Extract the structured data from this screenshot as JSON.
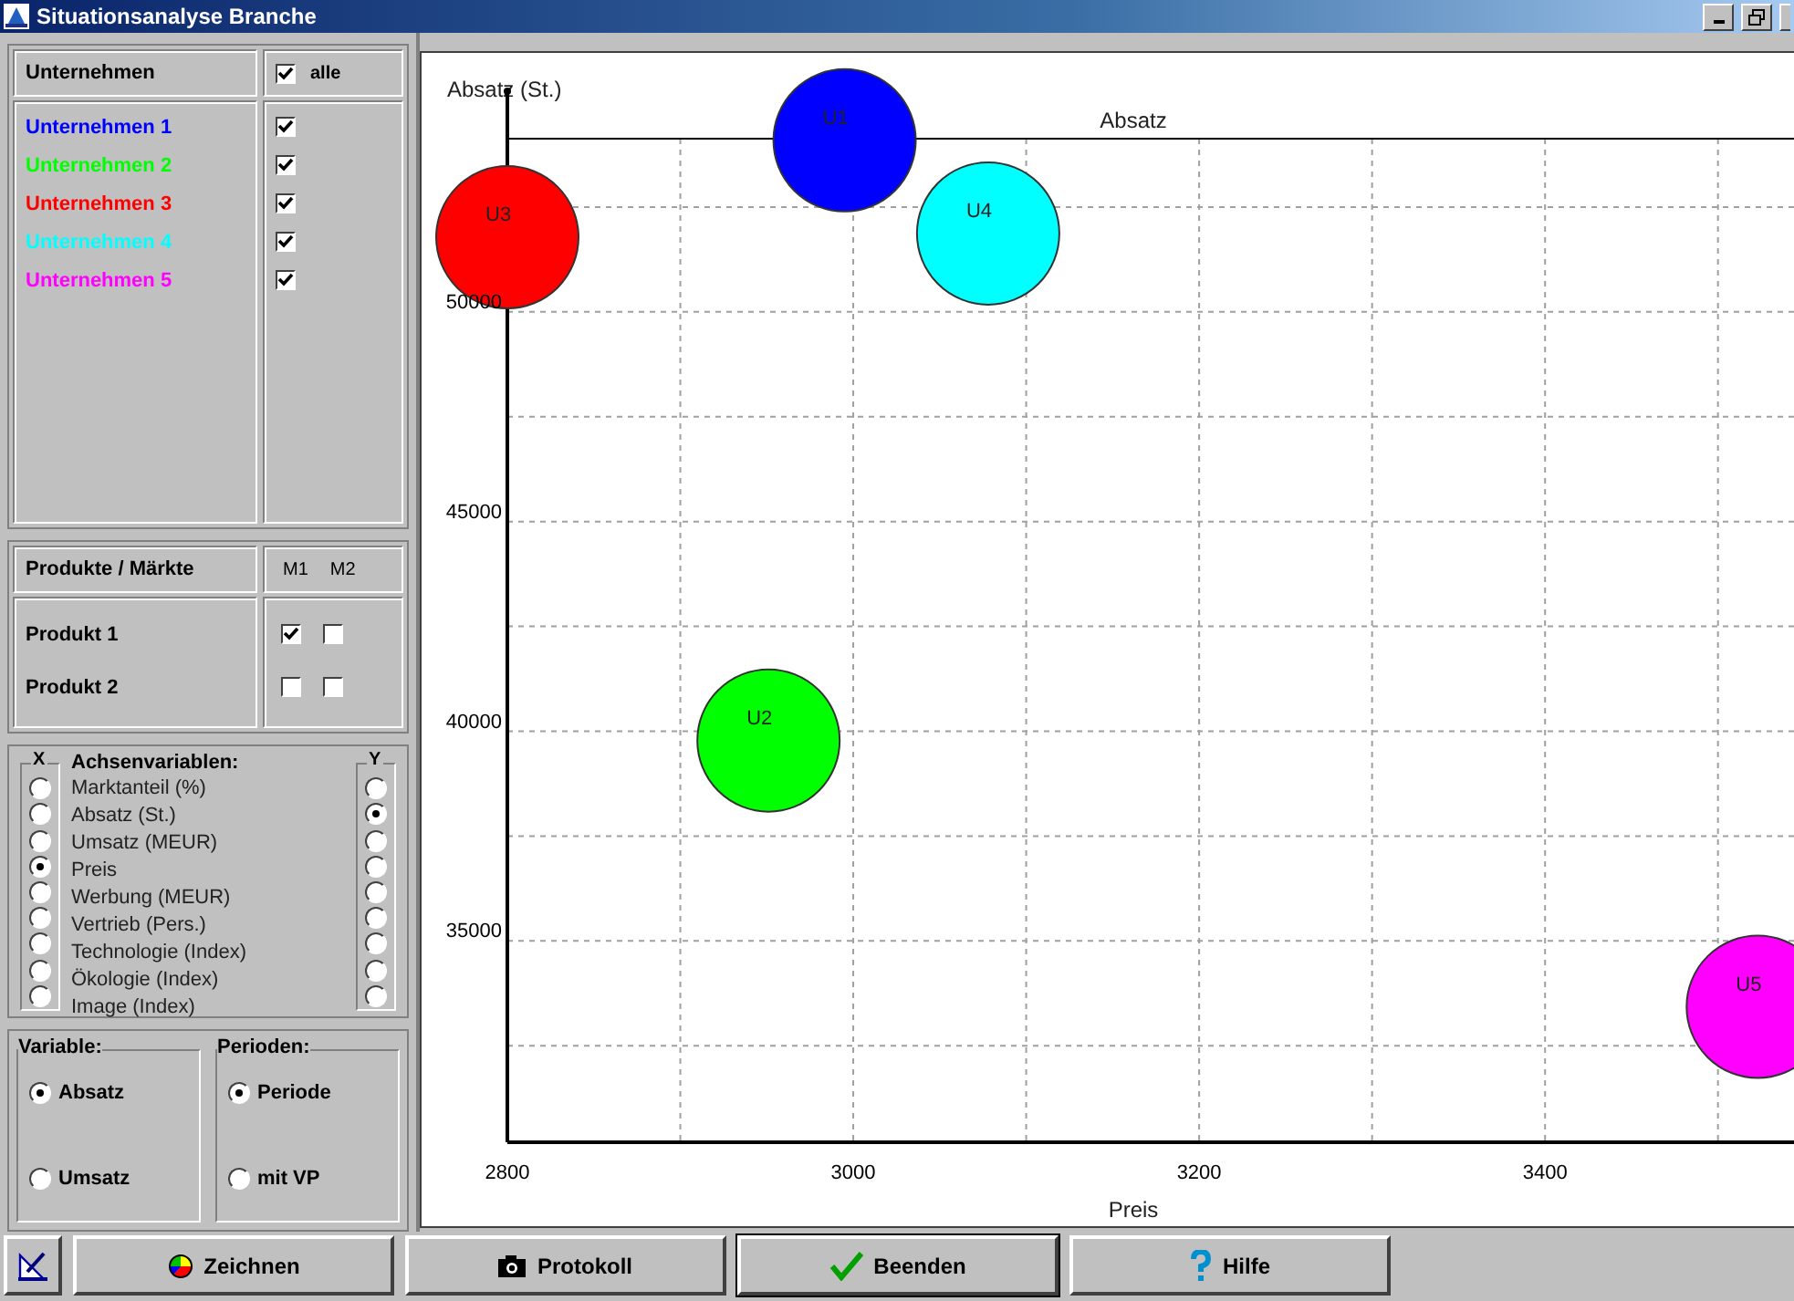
{
  "window": {
    "title": "Situationsanalyse Branche"
  },
  "companies": {
    "header": "Unternehmen",
    "all_label": "alle",
    "all_checked": true,
    "items": [
      {
        "label": "Unternehmen 1",
        "color": "#0000ff",
        "checked": true
      },
      {
        "label": "Unternehmen 2",
        "color": "#00ff00",
        "checked": true
      },
      {
        "label": "Unternehmen 3",
        "color": "#ff0000",
        "checked": true
      },
      {
        "label": "Unternehmen 4",
        "color": "#00ffff",
        "checked": true
      },
      {
        "label": "Unternehmen 5",
        "color": "#ff00ff",
        "checked": true
      }
    ]
  },
  "products": {
    "header": "Produkte / Märkte",
    "columns": [
      "M1",
      "M2"
    ],
    "items": [
      {
        "label": "Produkt 1",
        "m1_checked": true,
        "m2_checked": false
      },
      {
        "label": "Produkt 2",
        "m1_checked": false,
        "m2_checked": false
      }
    ]
  },
  "axis_variables": {
    "x_label": "X",
    "y_label": "Y",
    "title": "Achsenvariablen:",
    "items": [
      {
        "label": "Marktanteil (%)",
        "x_selected": false,
        "y_selected": false
      },
      {
        "label": "Absatz (St.)",
        "x_selected": false,
        "y_selected": true
      },
      {
        "label": "Umsatz (MEUR)",
        "x_selected": false,
        "y_selected": false
      },
      {
        "label": "Preis",
        "x_selected": true,
        "y_selected": false
      },
      {
        "label": "Werbung (MEUR)",
        "x_selected": false,
        "y_selected": false
      },
      {
        "label": "Vertrieb (Pers.)",
        "x_selected": false,
        "y_selected": false
      },
      {
        "label": "Technologie (Index)",
        "x_selected": false,
        "y_selected": false
      },
      {
        "label": "Ökologie (Index)",
        "x_selected": false,
        "y_selected": false
      },
      {
        "label": "Image (Index)",
        "x_selected": false,
        "y_selected": false
      }
    ]
  },
  "variable": {
    "title": "Variable:",
    "options": [
      {
        "label": "Absatz",
        "selected": true
      },
      {
        "label": "Umsatz",
        "selected": false
      }
    ]
  },
  "periods": {
    "title": "Perioden:",
    "options": [
      {
        "label": "Periode",
        "selected": true
      },
      {
        "label": "mit VP",
        "selected": false
      }
    ]
  },
  "chart": {
    "chart_data": {
      "type": "scatter",
      "grid": true,
      "title": "Absatz",
      "xlabel": "Preis",
      "ylabel": "Absatz (St.)",
      "xlim": [
        2800,
        3545
      ],
      "ylim": [
        30200,
        54130
      ],
      "xticks": [
        2800,
        3000,
        3200,
        3400
      ],
      "yticks": [
        35000,
        40000,
        45000,
        50000
      ],
      "series": [
        {
          "name": "U1",
          "color": "#0000ff",
          "x": [
            2995
          ],
          "values": [
            54090
          ]
        },
        {
          "name": "U2",
          "color": "#00ff00",
          "x": [
            2951
          ],
          "values": [
            39780
          ]
        },
        {
          "name": "U3",
          "color": "#ff0000",
          "x": [
            2800
          ],
          "values": [
            51780
          ]
        },
        {
          "name": "U4",
          "color": "#00ffff",
          "x": [
            3078
          ],
          "values": [
            51870
          ]
        },
        {
          "name": "U5",
          "color": "#ff00ff",
          "x": [
            3523
          ],
          "values": [
            33430
          ]
        }
      ]
    }
  },
  "buttons": [
    {
      "kind": "tool"
    },
    {
      "kind": "draw",
      "label": "Zeichnen"
    },
    {
      "kind": "camera",
      "label": "Protokoll"
    },
    {
      "kind": "check",
      "label": "Beenden",
      "default": true
    },
    {
      "kind": "help",
      "label": "Hilfe"
    }
  ]
}
